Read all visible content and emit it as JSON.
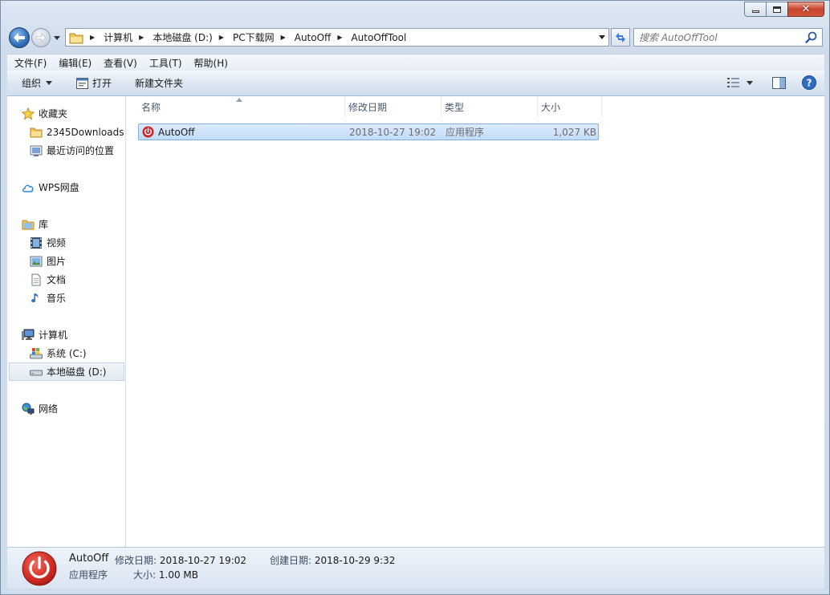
{
  "window": {
    "caption_close": "✕"
  },
  "navigation": {
    "breadcrumbs": [
      "计算机",
      "本地磁盘 (D:)",
      "PC下载网",
      "AutoOff",
      "AutoOffTool"
    ],
    "search_placeholder": "搜索 AutoOffTool"
  },
  "menubar": {
    "items": [
      "文件(F)",
      "编辑(E)",
      "查看(V)",
      "工具(T)",
      "帮助(H)"
    ]
  },
  "commandbar": {
    "organize": "组织",
    "open": "打开",
    "new_folder": "新建文件夹"
  },
  "nav_pane": {
    "favorites": "收藏夹",
    "fav_items": [
      "2345Downloads",
      "最近访问的位置"
    ],
    "wps": "WPS网盘",
    "library": "库",
    "lib_items": [
      "视频",
      "图片",
      "文档",
      "音乐"
    ],
    "computer": "计算机",
    "drives": [
      "系统 (C:)",
      "本地磁盘 (D:)"
    ],
    "network": "网络"
  },
  "columns": {
    "name": "名称",
    "modified": "修改日期",
    "type": "类型",
    "size": "大小"
  },
  "files": [
    {
      "name": "AutoOff",
      "modified": "2018-10-27 19:02",
      "type": "应用程序",
      "size": "1,027 KB"
    }
  ],
  "details": {
    "name": "AutoOff",
    "type": "应用程序",
    "modified_label": "修改日期:",
    "modified_value": "2018-10-27 19:02",
    "size_label": "大小:",
    "size_value": "1.00 MB",
    "created_label": "创建日期:",
    "created_value": "2018-10-29 9:32"
  },
  "colors": {
    "accent": "#2e6fb8",
    "selection": "#c1dcfc",
    "power_icon": "#d0262a"
  }
}
